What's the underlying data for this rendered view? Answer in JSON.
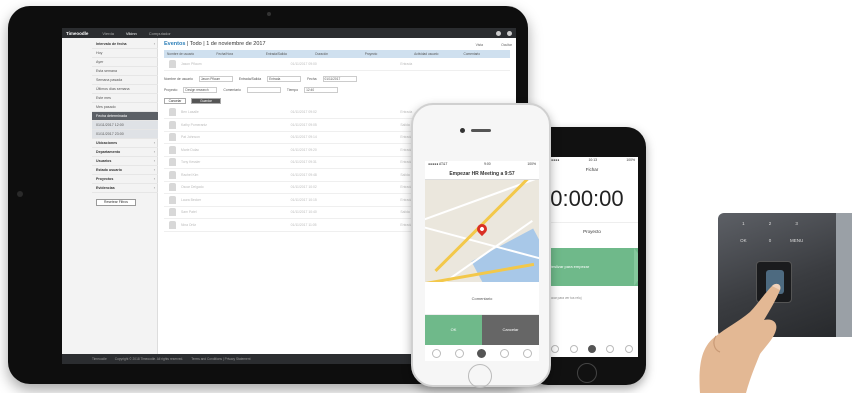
{
  "tablet": {
    "topnav": {
      "brand": "Timeoodle",
      "items": [
        "Vierda",
        "Vikinn",
        "Computador"
      ]
    },
    "sidebar": {
      "sections": [
        {
          "label": "Intervalo de fecha",
          "head": true
        },
        {
          "label": "Hoy"
        },
        {
          "label": "Ayer"
        },
        {
          "label": "Esta semana"
        },
        {
          "label": "Semana pasada"
        },
        {
          "label": "Últimos días semana"
        },
        {
          "label": "Este mes"
        },
        {
          "label": "Mes pasado"
        },
        {
          "label": "Fecha determinada",
          "active": true
        },
        {
          "label": "01/11/2017 12:00",
          "filter": true
        },
        {
          "label": "01/11/2017 23:00",
          "filter": true
        },
        {
          "label": "Ubicaciones",
          "head": true
        },
        {
          "label": "Departamento",
          "head": true
        },
        {
          "label": "Usuarios",
          "head": true
        },
        {
          "label": "Estado usuario",
          "head": true
        },
        {
          "label": "Proyectos",
          "head": true
        },
        {
          "label": "Evidencias",
          "head": true
        }
      ],
      "reset_button": "Resetear Filtros"
    },
    "content": {
      "title_main": "Eventos",
      "title_rest": " | Todo | 1 de noviembre de 2017",
      "right_links": [
        "Vista",
        "Ocultar"
      ],
      "columns": [
        "Nombre de usuario",
        "Fecha/Hora",
        "Entrada/Salida",
        "Duración",
        "Proyecto",
        "Actividad usuario",
        "Comentario"
      ],
      "form": {
        "user_label": "Nombre de usuario",
        "user_value": "Jason Pflaum",
        "type_label": "Entrada/Salida",
        "type_value": "Entrada",
        "date_label": "Fecha",
        "date_value": "01/11/2017",
        "project_label": "Proyecto",
        "project_value": "Design research",
        "comment_label": "Comentario",
        "time_label": "Tiempo",
        "time_value": "12:40",
        "cancel": "Cancelar",
        "save": "Guardar"
      },
      "rows": [
        {
          "name": "Jason Pflaum",
          "time": "01/11/2017 09:00",
          "type": "Entrada"
        },
        {
          "name": "Ben Lasalle",
          "time": "01/11/2017 09:02",
          "type": "Entrada"
        },
        {
          "name": "Kathy Pomerantz",
          "time": "01/11/2017 09:05",
          "type": "Salida"
        },
        {
          "name": "Pat Johnson",
          "time": "01/11/2017 09:14",
          "type": "Entrada"
        },
        {
          "name": "Marie Dulac",
          "time": "01/11/2017 09:20",
          "type": "Entrada"
        },
        {
          "name": "Tony Kessler",
          "time": "01/11/2017 09:31",
          "type": "Entrada"
        },
        {
          "name": "Rachel Kim",
          "time": "01/11/2017 09:48",
          "type": "Salida"
        },
        {
          "name": "Oscar Delgado",
          "time": "01/11/2017 10:02",
          "type": "Entrada"
        },
        {
          "name": "Laura Becker",
          "time": "01/11/2017 10:15",
          "type": "Entrada"
        },
        {
          "name": "Sam Patel",
          "time": "01/11/2017 10:40",
          "type": "Salida"
        },
        {
          "name": "Nina Ortiz",
          "time": "01/11/2017 11:05",
          "type": "Entrada"
        }
      ]
    },
    "footer": {
      "brand": "Timeoodle",
      "copyright": "Copyright © 2018 Timeoodle. All rights reserved.",
      "links": "Terms and Conditions  |  Privacy Statement"
    }
  },
  "phone_white": {
    "status_left": "●●●●● AT&T",
    "status_time": "9:00",
    "status_right": "100%",
    "title": "Empezar HR Meeting a 9:57",
    "comment": "Comentario",
    "ok": "OK",
    "cancel": "Cancelar"
  },
  "phone_black": {
    "status_left": "●●●●●",
    "status_time": "10:13",
    "status_right": "100%",
    "title": "Fichar",
    "clock": "00:00:00",
    "label": "Proyecto",
    "swipe": "Deslizar para empezar",
    "note": "Tocar para ver tus reloj"
  },
  "terminal": {
    "keys": [
      "1",
      "2",
      "3",
      "OK",
      "0",
      "MENU"
    ]
  }
}
